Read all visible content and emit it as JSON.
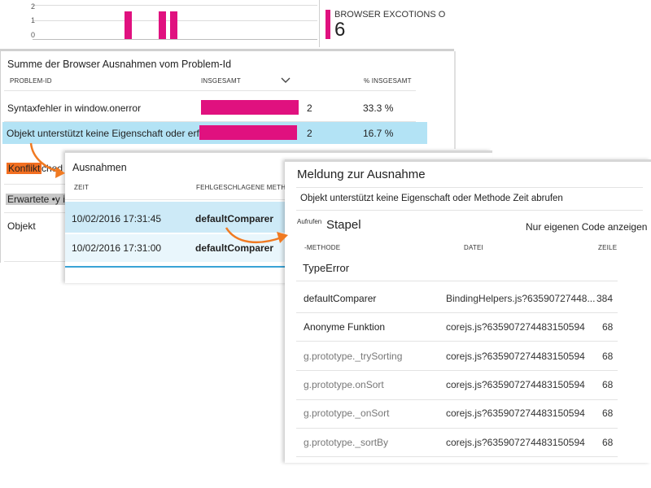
{
  "top_chart": {
    "y_ticks": [
      "2",
      "1",
      "0"
    ],
    "bar_color": "#e0117f",
    "bar_values": [
      2,
      2,
      2
    ]
  },
  "tile": {
    "title": "BROWSER EXCOTIONS O",
    "value": "6",
    "accent": "#e0117f"
  },
  "problems": {
    "title": "Summe der Browser Ausnahmen vom Problem-Id",
    "col_problem": "PROBLEM-ID",
    "col_total": "INSGESAMT",
    "col_pct": "% INSGESAMT",
    "rows": [
      {
        "label": "Syntaxfehler in window.onerror",
        "count": "2",
        "pct": "33.3 %",
        "bar_fraction": 1.0
      },
      {
        "label": "Objekt unterstützt keine Eigenschaft oder erfüllt.",
        "count": "2",
        "pct": "16.7 %",
        "bar_fraction": 1.0
      }
    ],
    "partial_rows": [
      "Konflikt",
      "ched",
      "Erwartete •y ich",
      "Objekt"
    ]
  },
  "exceptions": {
    "title": "Ausnahmen",
    "col_time": "ZEIT",
    "col_method": "FEHLGESCHLAGENE METHODE",
    "rows": [
      {
        "time": "10/02/2016 17:31:45",
        "method": "defaultComparer"
      },
      {
        "time": "10/02/2016 17:31:00",
        "method": "defaultComparer"
      }
    ]
  },
  "detail": {
    "title": "Meldung zur Ausnahme",
    "message": "Objekt unterstützt keine Eigenschaft oder Methode Zeit abrufen",
    "calls_label": "Aufrufen",
    "stack_label": "Stapel",
    "own_code_label": "Nur eigenen Code anzeigen",
    "col_method": "-METHODE",
    "col_file": "DATEI",
    "col_line": "ZEILE",
    "exception_type": "TypeError",
    "frames": [
      {
        "method": "defaultComparer",
        "file": "BindingHelpers.js?63590727448...",
        "line": "384",
        "own": true
      },
      {
        "method": "Anonyme Funktion",
        "file": "corejs.js?635907274483150594",
        "line": "68",
        "own": true
      },
      {
        "method": "g.prototype._trySorting",
        "file": "corejs.js?635907274483150594",
        "line": "68",
        "own": false
      },
      {
        "method": "g.prototype.onSort",
        "file": "corejs.js?635907274483150594",
        "line": "68",
        "own": false
      },
      {
        "method": "g.prototype._onSort",
        "file": "corejs.js?635907274483150594",
        "line": "68",
        "own": false
      },
      {
        "method": "g.prototype._sortBy",
        "file": "corejs.js?635907274483150594",
        "line": "68",
        "own": false
      }
    ]
  },
  "colors": {
    "selected_row": "#b3e3f5",
    "arrow": "#f07a22",
    "konflikt_bg": "#f26f21",
    "erwartete_bg": "#c8c8c8"
  }
}
